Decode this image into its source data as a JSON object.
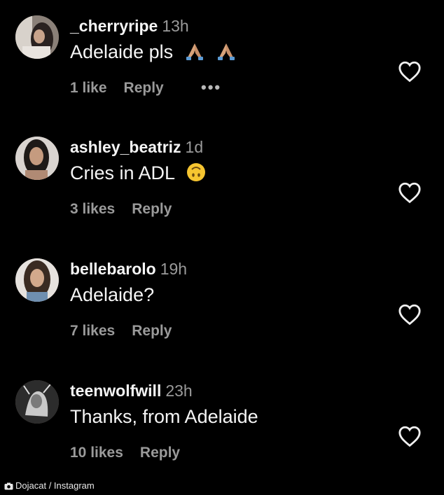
{
  "comments": [
    {
      "username": "_cherryripe",
      "time": "13h",
      "text": "Adelaide pls",
      "likes": "1 like",
      "reply": "Reply",
      "more": "•••",
      "emoji": "folded-hands-emoji"
    },
    {
      "username": "ashley_beatriz",
      "time": "1d",
      "text": "Cries in ADL",
      "likes": "3 likes",
      "reply": "Reply",
      "emoji": "upside-down-face-emoji"
    },
    {
      "username": "bellebarolo",
      "time": "19h",
      "text": "Adelaide?",
      "likes": "7 likes",
      "reply": "Reply"
    },
    {
      "username": "teenwolfwill",
      "time": "23h",
      "text": "Thanks, from Adelaide",
      "likes": "10 likes",
      "reply": "Reply"
    }
  ],
  "credit": {
    "text": "Dojacat / Instagram",
    "icon": "camera-icon"
  },
  "colors": {
    "background": "#000000",
    "text": "#f5f5f5",
    "muted": "#9a9a9a",
    "emoji_skin": "#d8a37a",
    "emoji_face": "#f6c530"
  }
}
